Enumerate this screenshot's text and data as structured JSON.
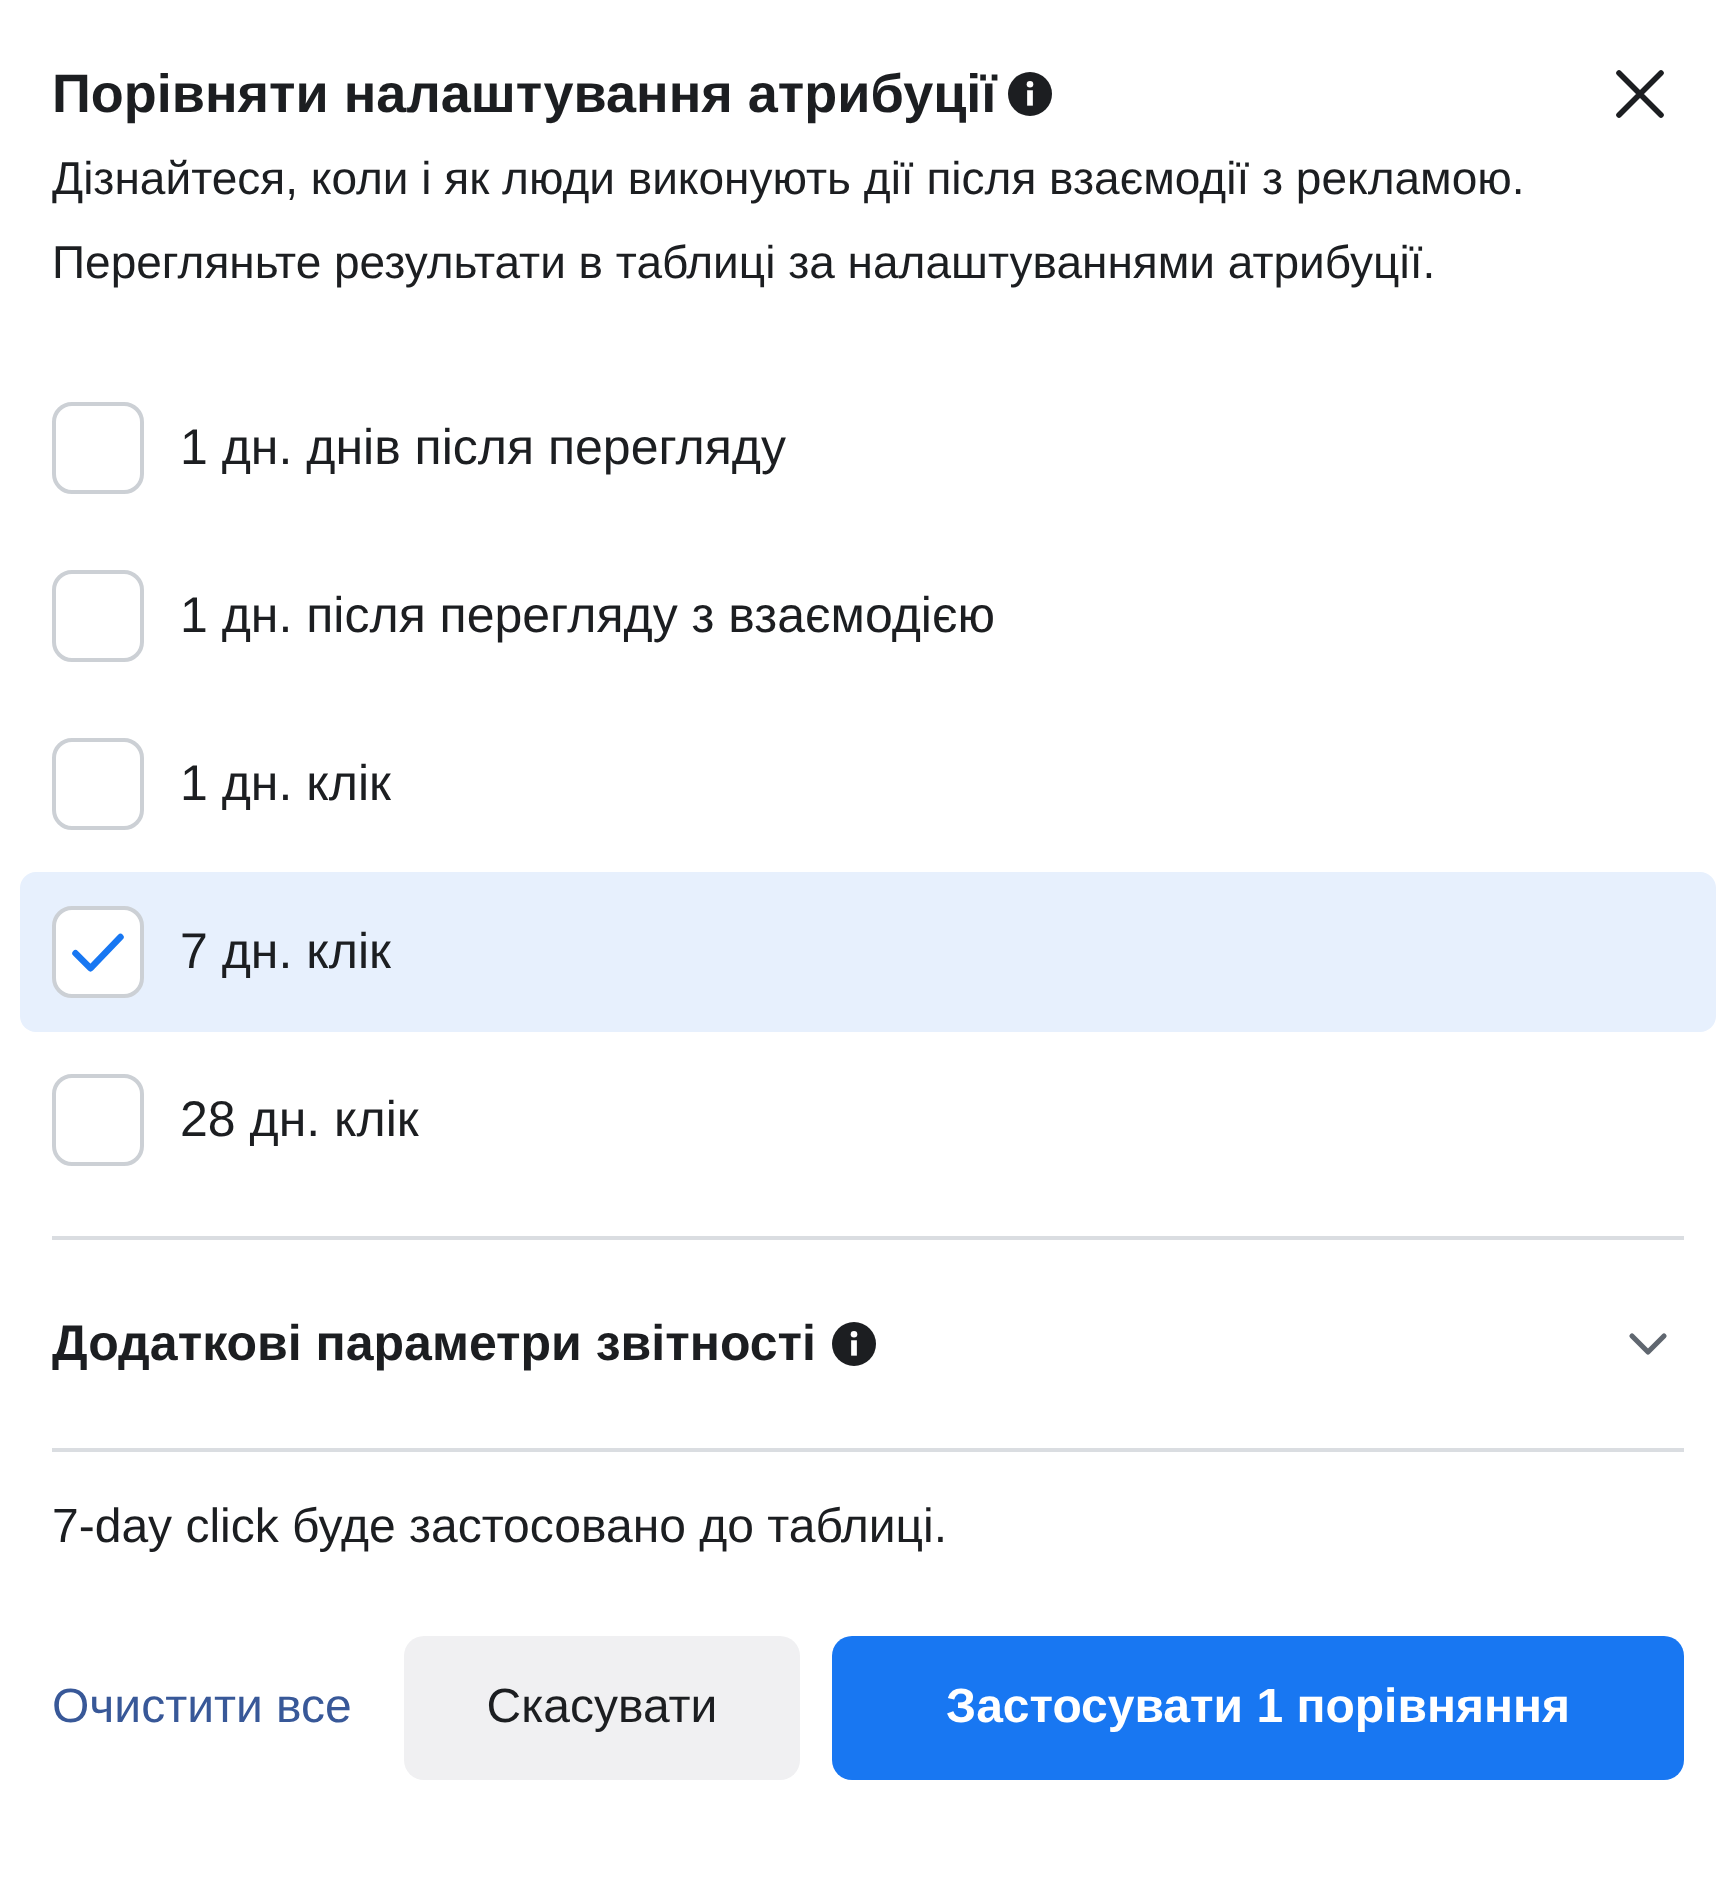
{
  "dialog": {
    "title": "Порівняти налаштування атрибуції",
    "description": "Дізнайтеся, коли і як люди виконують дії після взаємодії з рекламою. Перегляньте результати в таблиці за налаштуваннями атрибуції."
  },
  "options": [
    {
      "label": "1 дн. днів після перегляду",
      "checked": false
    },
    {
      "label": "1 дн. після перегляду з взаємодією",
      "checked": false
    },
    {
      "label": "1 дн. клік",
      "checked": false
    },
    {
      "label": "7 дн. клік",
      "checked": true
    },
    {
      "label": "28 дн. клік",
      "checked": false
    }
  ],
  "additional_section": {
    "title": "Додаткові параметри звітності",
    "expanded": false
  },
  "summary": "7-day click буде застосовано до таблиці.",
  "buttons": {
    "clear": "Очистити все",
    "cancel": "Скасувати",
    "apply": "Застосувати 1 порівняння"
  }
}
